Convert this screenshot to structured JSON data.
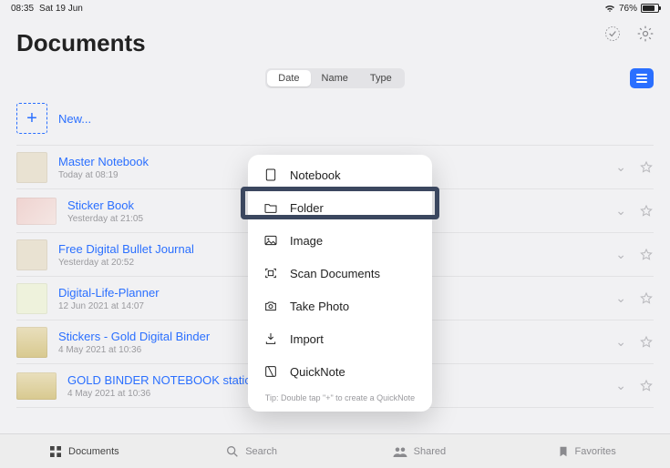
{
  "statusbar": {
    "time": "08:35",
    "date": "Sat 19 Jun",
    "battery_pct": "76%"
  },
  "header": {
    "title": "Documents"
  },
  "sort": {
    "options": [
      "Date",
      "Name",
      "Type"
    ],
    "active": "Date"
  },
  "new_row": {
    "label": "New..."
  },
  "items": [
    {
      "name": "Master Notebook",
      "sub": "Today at 08:19",
      "thumb": "cream"
    },
    {
      "name": "Sticker Book",
      "sub": "Yesterday at 21:05",
      "thumb": "pink"
    },
    {
      "name": "Free Digital Bullet Journal",
      "sub": "Yesterday at 20:52",
      "thumb": "cream"
    },
    {
      "name": "Digital-Life-Planner",
      "sub": "12 Jun 2021 at 14:07",
      "thumb": "green"
    },
    {
      "name": "Stickers - Gold Digital Binder",
      "sub": "4 May 2021 at 10:36",
      "thumb": "gold"
    },
    {
      "name": "GOLD BINDER NOTEBOOK static background V3",
      "sub": "4 May 2021 at 10:36",
      "thumb": "gold"
    }
  ],
  "popover": {
    "items": [
      {
        "icon": "notebook-icon",
        "label": "Notebook"
      },
      {
        "icon": "folder-icon",
        "label": "Folder"
      },
      {
        "icon": "image-icon",
        "label": "Image"
      },
      {
        "icon": "scan-icon",
        "label": "Scan Documents"
      },
      {
        "icon": "camera-icon",
        "label": "Take Photo"
      },
      {
        "icon": "import-icon",
        "label": "Import"
      },
      {
        "icon": "quicknote-icon",
        "label": "QuickNote"
      }
    ],
    "highlight_index": 1,
    "tip": "Tip: Double tap \"+\" to create a QuickNote"
  },
  "tabs": [
    {
      "icon": "grid-icon",
      "label": "Documents",
      "active": true
    },
    {
      "icon": "search-icon",
      "label": "Search",
      "active": false
    },
    {
      "icon": "shared-icon",
      "label": "Shared",
      "active": false
    },
    {
      "icon": "favorites-icon",
      "label": "Favorites",
      "active": false
    }
  ]
}
